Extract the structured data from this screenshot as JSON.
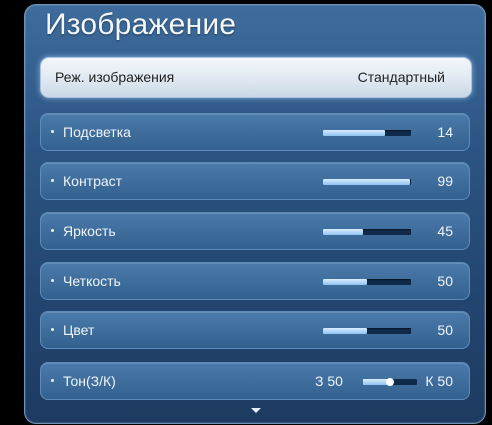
{
  "menu": {
    "title": "Изображение",
    "picture_mode": {
      "label": "Реж. изображения",
      "value": "Стандартный"
    },
    "settings": [
      {
        "key": "backlight",
        "label": "Подсветка",
        "value": 14,
        "max": 20,
        "display": "14"
      },
      {
        "key": "contrast",
        "label": "Контраст",
        "value": 99,
        "max": 100,
        "display": "99"
      },
      {
        "key": "brightness",
        "label": "Яркость",
        "value": 45,
        "max": 100,
        "display": "45"
      },
      {
        "key": "sharpness",
        "label": "Четкость",
        "value": 50,
        "max": 100,
        "display": "50"
      },
      {
        "key": "color",
        "label": "Цвет",
        "value": 50,
        "max": 100,
        "display": "50"
      }
    ],
    "tint": {
      "label": "Тон(З/К)",
      "green_display": "З 50",
      "red_display": "К 50",
      "green": 50,
      "red": 50
    },
    "more_indicator": "chevron-down-icon"
  }
}
